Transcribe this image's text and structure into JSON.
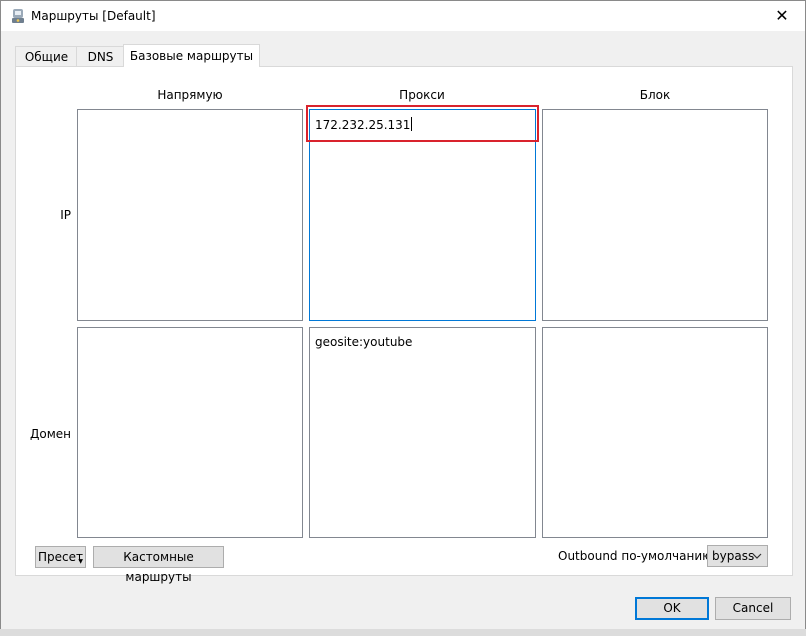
{
  "window": {
    "title": "Маршруты [Default]",
    "close_glyph": "✕"
  },
  "tabs": [
    {
      "label": "Общие"
    },
    {
      "label": "DNS"
    },
    {
      "label": "Базовые маршруты",
      "active": true
    }
  ],
  "grid": {
    "columns": [
      "Напрямую",
      "Прокси",
      "Блок"
    ],
    "rows": [
      "IP",
      "Домен"
    ],
    "cells": {
      "ip_direct": "",
      "ip_proxy": "172.232.25.131",
      "ip_block": "",
      "domain_direct": "",
      "domain_proxy": "geosite:youtube",
      "domain_block": ""
    }
  },
  "footer": {
    "preset_label": "Пресет",
    "custom_routes_label": "Кастомные маршруты",
    "outbound_label": "Outbound по-умолчанию",
    "outbound_value": "bypass"
  },
  "dialog_buttons": {
    "ok": "OK",
    "cancel": "Cancel"
  },
  "colors": {
    "accent": "#0078d7",
    "highlight": "#d9232d"
  }
}
